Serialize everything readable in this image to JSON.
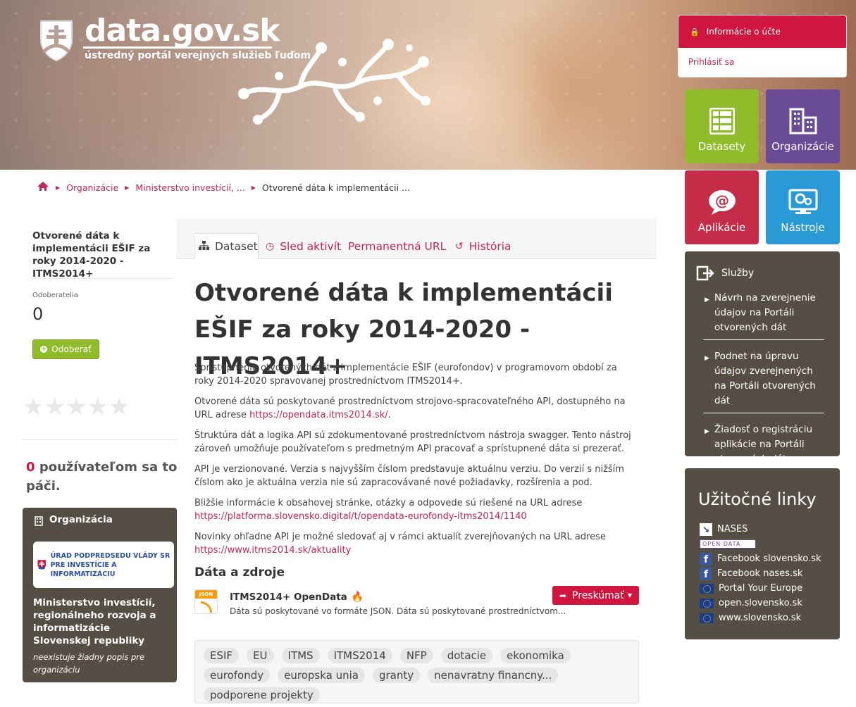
{
  "header": {
    "logo_title": "data.gov.sk",
    "logo_subtitle": "ústredný portál verejných služieb ľuďom"
  },
  "account": {
    "title": "Informácie o účte",
    "login": "Prihlásiť sa"
  },
  "tiles": {
    "datasets": "Datasety",
    "organizations": "Organizácie",
    "applications": "Aplikácie",
    "tools": "Nástroje"
  },
  "services": {
    "title": "Služby",
    "items": [
      "Návrh na zverejnenie údajov na Portáli otvorených dát",
      "Podnet na úpravu údajov zverejnených na Portáli otvorených dát",
      "Žiadosť o registráciu aplikácie na Portáli otvorených dát"
    ]
  },
  "useful_links": {
    "title": "Užitočné linky",
    "items": [
      {
        "label": "NASES",
        "icon": "nases-logo-icon"
      },
      {
        "label": "OPEN DATA",
        "icon": "open-data-logo-icon"
      },
      {
        "label": "Facebook slovensko.sk",
        "icon": "facebook-icon"
      },
      {
        "label": "Facebook nases.sk",
        "icon": "facebook-icon"
      },
      {
        "label": "Portal Your Europe",
        "icon": "eu-flag-icon"
      },
      {
        "label": "open.slovensko.sk",
        "icon": "eu-flag-icon"
      },
      {
        "label": "www.slovensko.sk",
        "icon": "eu-flag-icon"
      }
    ]
  },
  "breadcrumb": {
    "items": [
      "Organizácie",
      "Ministerstvo investícií, ...",
      "Otvorené dáta k implementácii ..."
    ]
  },
  "sidebar": {
    "title": "Otvorené dáta k implementácii EŠIF za roky 2014-2020 - ITMS2014+",
    "followers_label": "Odoberatelia",
    "followers_count": "0",
    "follow_button": "Odoberať",
    "stars": "★★★★★",
    "likes_count": "0",
    "likes_text": "používateľom sa to páči.",
    "org_box_title": "Organizácia",
    "org_logo_text": "ÚRAD PODPREDSEDU VLÁDY SR PRE INVESTÍCIE A INFORMATIZÁCIU",
    "org_name": "Ministerstvo investícií, regionálneho rozvoja a informatizácie Slovenskej republiky",
    "org_desc": "neexistuje žiadny popis pre organizáciu"
  },
  "tabs": {
    "dataset": "Dataset",
    "activity": "Sled aktivít",
    "permalink": "Permanentná URL",
    "history": "História"
  },
  "main": {
    "title": "Otvorené dáta k implementácii EŠIF za roky 2014-2020 - ITMS2014+",
    "p1": "Sprístupnenie otvorených dát z implementácie EŠIF (eurofondov) v programovom období za roky 2014-2020 spravovanej prostredníctvom ITMS2014+.",
    "p2_text": "Otvorené dáta sú poskytované prostredníctvom strojovo-spracovateľného API, dostupného na URL adrese ",
    "p2_link": "https://opendata.itms2014.sk/",
    "p2_end": ".",
    "p3": "Štruktúra dát a logika API sú zdokumentované prostredníctvom nástroja swagger. Tento nástroj zároveň umožňuje používateľom s predmetným API pracovať a sprístupnené dáta si prezerať.",
    "p4": "API je verzionované. Verzia s najvyšším číslom predstavuje aktuálnu verziu. Do verzií s nižším číslom ako je aktuálna verzia nie sú zapracovávané nové požiadavky, rozšírenia a pod.",
    "p5_text": "Bližšie informácie k obsahovej stránke, otázky a odpovede sú riešené na URL adrese",
    "p5_link": "https://platforma.slovensko.digital/t/opendata-eurofondy-itms2014/1140",
    "p6_text": "Novinky ohľadne API je možné sledovať aj v rámci aktualít zverejňovaných na URL adrese",
    "p6_link": "https://www.itms2014.sk/aktuality",
    "data_title": "Dáta a zdroje",
    "resource": {
      "icon_label": "JSON",
      "name": "ITMS2014+ OpenData",
      "desc": "Dáta sú poskytované vo formáte JSON. Dáta sú poskytované prostredníctvom...",
      "explore": "Preskúmať"
    },
    "tags": [
      "ESIF",
      "EU",
      "ITMS",
      "ITMS2014",
      "NFP",
      "dotacie",
      "ekonomika",
      "eurofondy",
      "europska unia",
      "granty",
      "nenavratny financny...",
      "podporene projekty"
    ]
  },
  "colors": {
    "brand_red": "#d0163f",
    "link": "#c5254f",
    "green": "#90bc2b",
    "purple": "#6a4c96",
    "blue": "#2a9ad6",
    "panel_brown": "#554e44"
  }
}
